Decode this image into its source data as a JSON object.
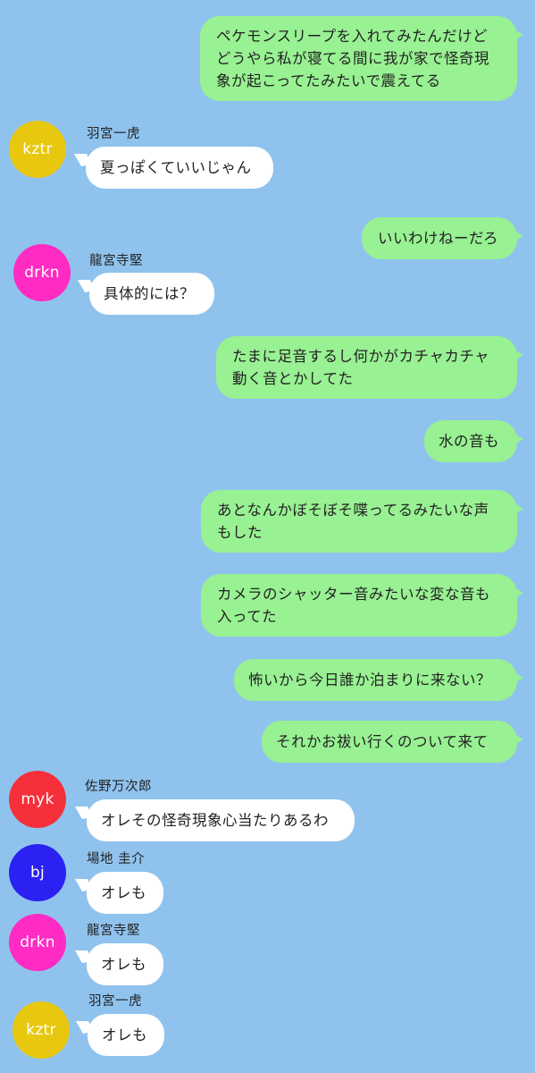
{
  "colors": {
    "background": "#8fc3ee",
    "my_bubble": "#98f192",
    "their_bubble": "#ffffff",
    "kztr": "#e8c80f",
    "drkn": "#ff2bc2",
    "myk": "#f5303a",
    "bj": "#2b21f2"
  },
  "messages": [
    {
      "type": "sent",
      "text": "ペケモンスリープを入れてみたんだけど\nどうやら私が寝てる間に我が家で怪奇現\n象が起こってたみたいで震えてる"
    },
    {
      "type": "received",
      "avatar": "kztr",
      "name": "羽宮一虎",
      "text": "夏っぽくていいじゃん"
    },
    {
      "type": "sent",
      "text": "いいわけねーだろ"
    },
    {
      "type": "received",
      "avatar": "drkn",
      "name": "龍宮寺堅",
      "text": "具体的には？"
    },
    {
      "type": "sent",
      "text": "たまに足音するし何かがカチャカチャ\n動く音とかしてた"
    },
    {
      "type": "sent",
      "text": "水の音も"
    },
    {
      "type": "sent",
      "text": "あとなんかぼそぼそ喋ってるみたいな声\nもした"
    },
    {
      "type": "sent",
      "text": "カメラのシャッター音みたいな変な音も\n入ってた"
    },
    {
      "type": "sent",
      "text": "怖いから今日誰か泊まりに来ない？"
    },
    {
      "type": "sent",
      "text": "それかお祓い行くのついて来て"
    },
    {
      "type": "received",
      "avatar": "myk",
      "name": "佐野万次郎",
      "text": "オレその怪奇現象心当たりあるわ"
    },
    {
      "type": "received",
      "avatar": "bj",
      "name": "場地 圭介",
      "text": "オレも"
    },
    {
      "type": "received",
      "avatar": "drkn",
      "name": "龍宮寺堅",
      "text": "オレも"
    },
    {
      "type": "received",
      "avatar": "kztr",
      "name": "羽宮一虎",
      "text": "オレも"
    }
  ]
}
